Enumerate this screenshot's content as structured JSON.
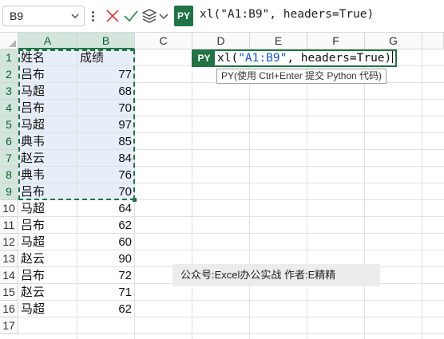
{
  "formula_bar": {
    "name_box": "B9",
    "py_badge": "PY",
    "formula": "xl(\"A1:B9\", headers=True)",
    "icons": [
      "more-icon",
      "cancel-icon",
      "enter-icon",
      "python-object-icon",
      "chevron-down-icon"
    ]
  },
  "columns": [
    "A",
    "B",
    "C",
    "D",
    "E",
    "F",
    "G"
  ],
  "rows": [
    "1",
    "2",
    "3",
    "4",
    "5",
    "6",
    "7",
    "8",
    "9",
    "10",
    "11",
    "12",
    "13",
    "14",
    "15",
    "16",
    "17"
  ],
  "cells": [
    {
      "a": "姓名",
      "b": "成绩"
    },
    {
      "a": "吕布",
      "b": "77"
    },
    {
      "a": "马超",
      "b": "68"
    },
    {
      "a": "吕布",
      "b": "70"
    },
    {
      "a": "马超",
      "b": "97"
    },
    {
      "a": "典韦",
      "b": "85"
    },
    {
      "a": "赵云",
      "b": "84"
    },
    {
      "a": "典韦",
      "b": "76"
    },
    {
      "a": "吕布",
      "b": "70"
    },
    {
      "a": "马超",
      "b": "64"
    },
    {
      "a": "吕布",
      "b": "62"
    },
    {
      "a": "马超",
      "b": "60"
    },
    {
      "a": "赵云",
      "b": "90"
    },
    {
      "a": "吕布",
      "b": "72"
    },
    {
      "a": "赵云",
      "b": "71"
    },
    {
      "a": "马超",
      "b": "62"
    },
    {
      "a": "",
      "b": ""
    }
  ],
  "editor": {
    "badge": "PY",
    "text_prefix": "xl(",
    "text_string": "\"A1:B9\"",
    "text_suffix": ", headers=True)",
    "tooltip": "PY(使用 Ctrl+Enter 提交 Python 代码)"
  },
  "watermark": "公众号:Excel办公实战  作者:E精精",
  "colors": {
    "accent": "#217346",
    "selection_fill": "#e7eef9",
    "header_selected": "#d2e6dc",
    "string_literal": "#1a56c2"
  }
}
